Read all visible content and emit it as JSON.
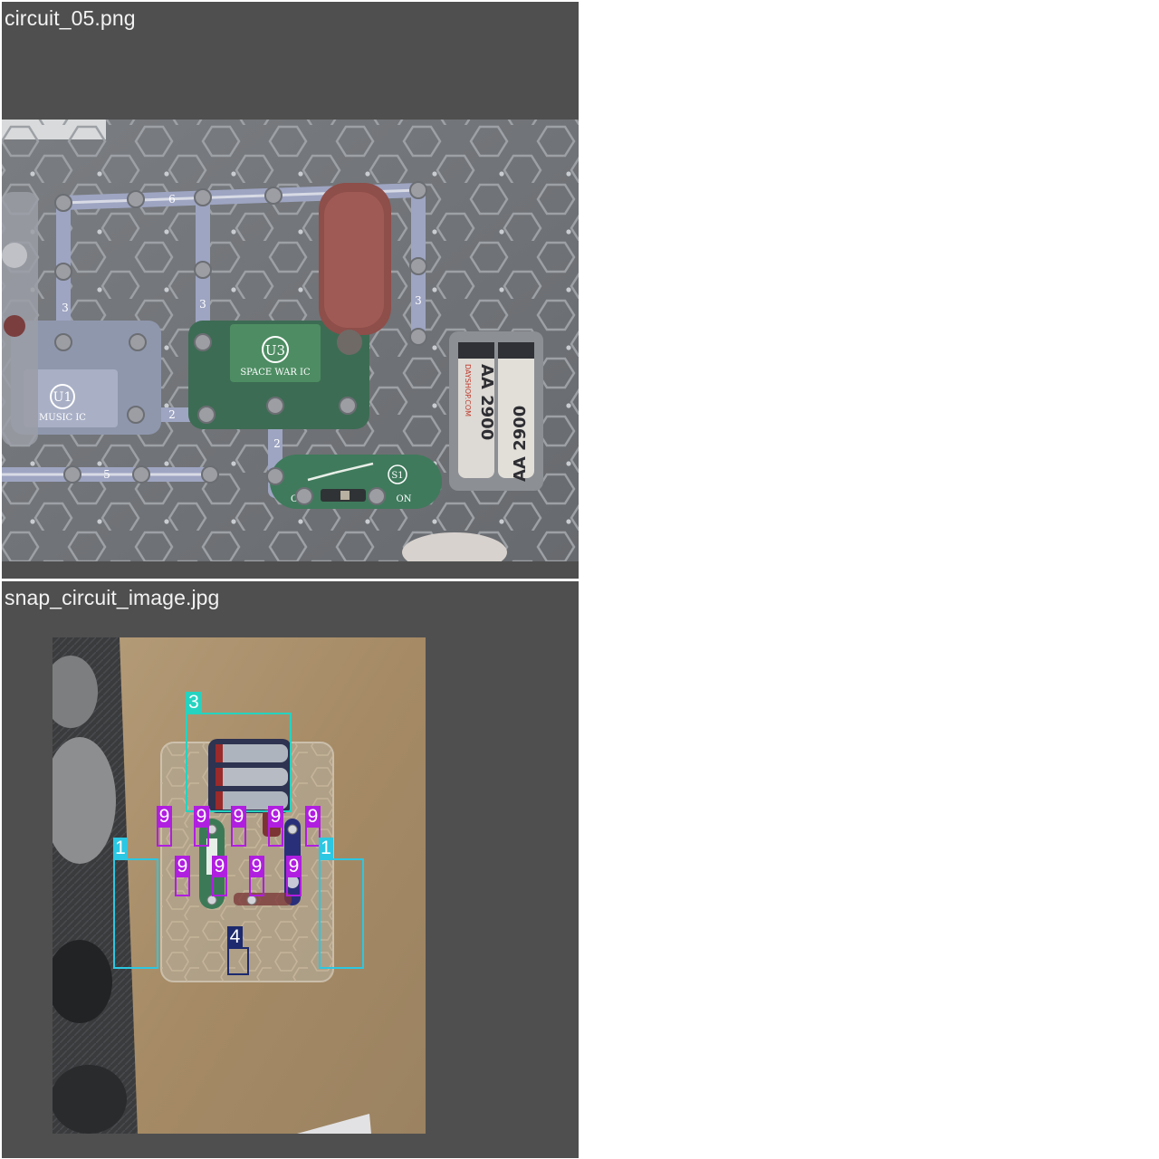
{
  "tiles": [
    {
      "caption": "circuit_05.png"
    },
    {
      "caption": "snap_circuit_image.jpg"
    }
  ],
  "board_text": {
    "u1_badge": "U1",
    "u1_name": "MUSIC IC",
    "u3_badge": "U3",
    "u3_name": "SPACE WAR IC",
    "s1_badge": "S1",
    "off": "OFF",
    "on": "ON",
    "battery_left": "AA 2900",
    "battery_right": "AA 2900",
    "battery_brand": "DAYSHOP.COM",
    "wire_nums": [
      "6",
      "3",
      "3",
      "3",
      "2",
      "2",
      "5"
    ]
  },
  "detections": [
    {
      "label": "3",
      "color": "#26d3c0"
    },
    {
      "label": "9",
      "color": "#b01ee0"
    },
    {
      "label": "9",
      "color": "#b01ee0"
    },
    {
      "label": "9",
      "color": "#b01ee0"
    },
    {
      "label": "9",
      "color": "#b01ee0"
    },
    {
      "label": "9",
      "color": "#b01ee0"
    },
    {
      "label": "9",
      "color": "#b01ee0"
    },
    {
      "label": "9",
      "color": "#b01ee0"
    },
    {
      "label": "9",
      "color": "#b01ee0"
    },
    {
      "label": "9",
      "color": "#b01ee0"
    },
    {
      "label": "1",
      "color": "#2cc7e2"
    },
    {
      "label": "1",
      "color": "#2cc7e2"
    },
    {
      "label": "4",
      "color": "#1d2a6e"
    }
  ]
}
